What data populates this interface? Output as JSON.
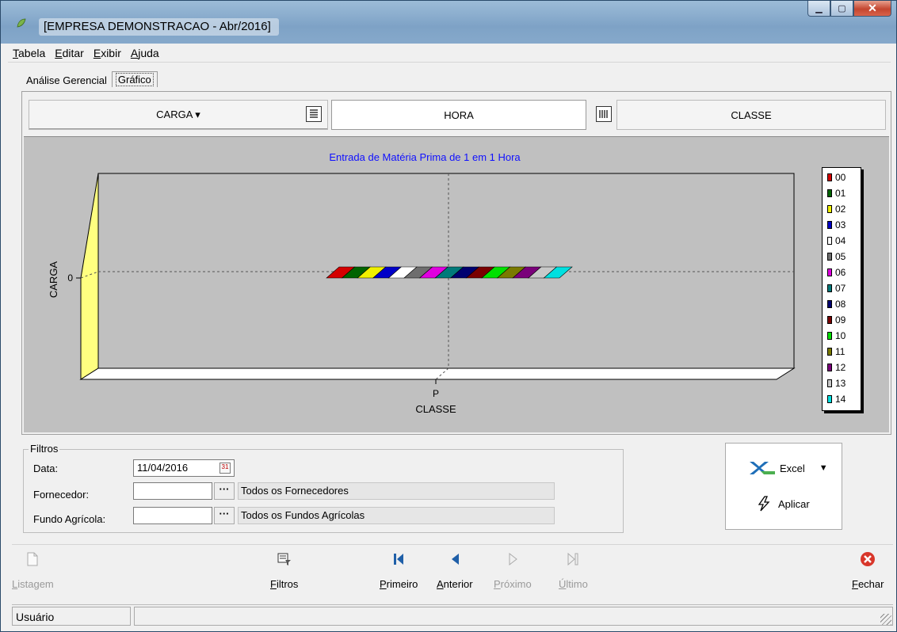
{
  "window": {
    "title": "[EMPRESA DEMONSTRACAO - Abr/2016]"
  },
  "menu": [
    "Tabela",
    "Editar",
    "Exibir",
    "Ajuda"
  ],
  "tabs": [
    {
      "label": "Análise Gerencial"
    },
    {
      "label": "Gráfico"
    }
  ],
  "pivot": {
    "rows_field": "CARGA ▾",
    "middle_field": "HORA",
    "cols_field": "CLASSE"
  },
  "chart_data": {
    "type": "bar",
    "title": "Entrada de Matéria Prima de 1 em 1 Hora",
    "ylabel": "CARGA",
    "xlabel": "CLASSE",
    "categories": [
      "P"
    ],
    "y_tick": "0",
    "series": [
      {
        "name": "00",
        "color": "#d40000",
        "values": [
          0
        ]
      },
      {
        "name": "01",
        "color": "#006400",
        "values": [
          0
        ]
      },
      {
        "name": "02",
        "color": "#f0f000",
        "values": [
          0
        ]
      },
      {
        "name": "03",
        "color": "#0000c8",
        "values": [
          0
        ]
      },
      {
        "name": "04",
        "color": "#ffffff",
        "values": [
          0
        ]
      },
      {
        "name": "05",
        "color": "#6e6e6e",
        "values": [
          0
        ]
      },
      {
        "name": "06",
        "color": "#e000e0",
        "values": [
          0
        ]
      },
      {
        "name": "07",
        "color": "#007a7a",
        "values": [
          0
        ]
      },
      {
        "name": "08",
        "color": "#000070",
        "values": [
          0
        ]
      },
      {
        "name": "09",
        "color": "#7a0000",
        "values": [
          0
        ]
      },
      {
        "name": "10",
        "color": "#00e000",
        "values": [
          0
        ]
      },
      {
        "name": "11",
        "color": "#7a7a00",
        "values": [
          0
        ]
      },
      {
        "name": "12",
        "color": "#7a007a",
        "values": [
          0
        ]
      },
      {
        "name": "13",
        "color": "#c8c8c8",
        "values": [
          0
        ]
      },
      {
        "name": "14",
        "color": "#00e0e0",
        "values": [
          0
        ]
      }
    ],
    "grid": true,
    "legend": "right"
  },
  "filters": {
    "group_label": "Filtros",
    "data_label": "Data:",
    "data_value": "11/04/2016",
    "fornecedor_label": "Fornecedor:",
    "fornecedor_value": "",
    "fornecedor_desc": "Todos os Fornecedores",
    "fundo_label": "Fundo Agrícola:",
    "fundo_value": "",
    "fundo_desc": "Todos os Fundos Agrícolas",
    "ellipsis": "···"
  },
  "actions": {
    "excel": "Excel",
    "aplicar": "Aplicar"
  },
  "toolbar": {
    "listagem": "Listagem",
    "filtros": "Filtros",
    "primeiro": "Primeiro",
    "anterior": "Anterior",
    "proximo": "Próximo",
    "ultimo": "Último",
    "fechar": "Fechar"
  },
  "status": {
    "user": "Usuário"
  }
}
